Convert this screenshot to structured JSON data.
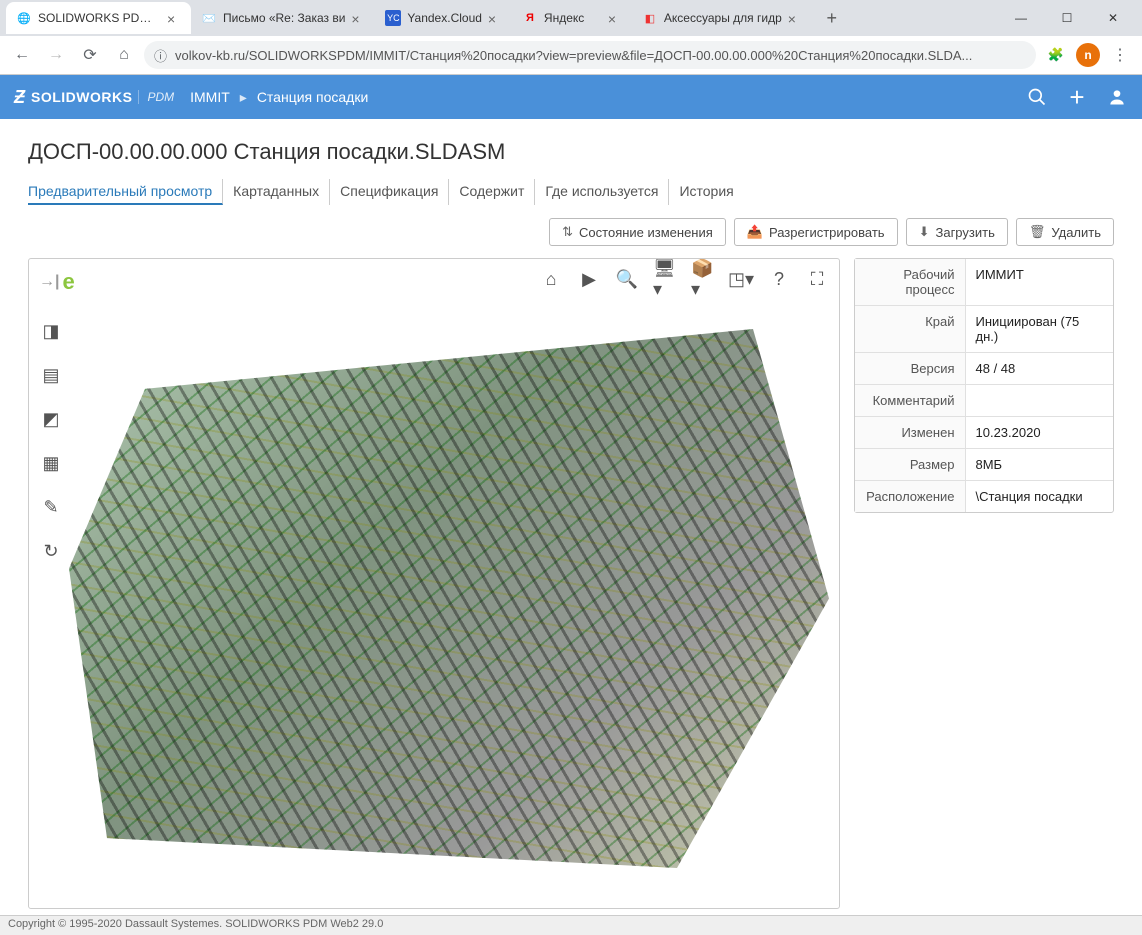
{
  "browser": {
    "tabs": [
      {
        "title": "SOLIDWORKS PDM W",
        "active": true
      },
      {
        "title": "Письмо «Re: Заказ ви"
      },
      {
        "title": "Yandex.Cloud"
      },
      {
        "title": "Яндекс"
      },
      {
        "title": "Аксессуары для гидр"
      }
    ],
    "url": "volkov-kb.ru/SOLIDWORKSPDM/IMMIT/Станция%20посадки?view=preview&file=ДОСП-00.00.00.000%20Станция%20посадки.SLDA...",
    "profile_initial": "n"
  },
  "header": {
    "brand_sw": "SOLIDWORKS",
    "brand_pdm": "PDM",
    "breadcrumb": [
      "IMMIT",
      "Станция посадки"
    ]
  },
  "page": {
    "title": "ДОСП-00.00.00.000 Станция посадки.SLDASM",
    "tabs": [
      {
        "label": "Предварительный просмотр",
        "active": true
      },
      {
        "label": "Картаданных"
      },
      {
        "label": "Спецификация"
      },
      {
        "label": "Содержит"
      },
      {
        "label": "Где используется"
      },
      {
        "label": "История"
      }
    ],
    "actions": [
      {
        "label": "Состояние изменения"
      },
      {
        "label": "Разрегистрировать"
      },
      {
        "label": "Загрузить"
      },
      {
        "label": "Удалить"
      }
    ]
  },
  "properties": [
    {
      "k": "Рабочий процесс",
      "v": "ИММИТ"
    },
    {
      "k": "Край",
      "v": "Инициирован (75 дн.)"
    },
    {
      "k": "Версия",
      "v": "48 / 48"
    },
    {
      "k": "Комментарий",
      "v": ""
    },
    {
      "k": "Изменен",
      "v": "10.23.2020"
    },
    {
      "k": "Размер",
      "v": "8МБ"
    },
    {
      "k": "Расположение",
      "v": "\\Станция посадки"
    }
  ],
  "footer": "Copyright © 1995-2020 Dassault Systemes. SOLIDWORKS PDM Web2 29.0"
}
